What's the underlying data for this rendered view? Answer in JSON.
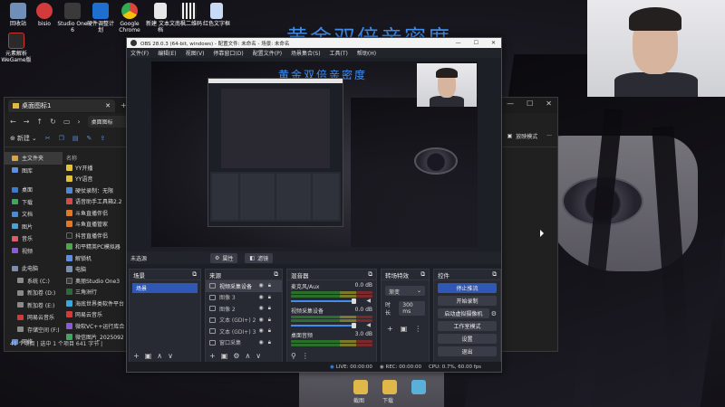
{
  "overlay": {
    "title_main": "黄金双倍亲密度"
  },
  "desktop_icons": [
    {
      "label": "回收站",
      "color": "#6f8fb8"
    },
    {
      "label": "bisio",
      "color": "#d23b3b"
    },
    {
      "label": "Studio One 6",
      "color": "#3a3a3a"
    },
    {
      "label": "硬件调整计划",
      "color": "#1f6fd1"
    },
    {
      "label": "Google Chrome",
      "color": "#e6a21c"
    },
    {
      "label": "新建 文本文档",
      "color": "#e7e7e7"
    },
    {
      "label": "南枫二维码",
      "color": "#f0f0f0"
    },
    {
      "label": "红色文字框",
      "color": "#c9daf7"
    },
    {
      "label": "元素解析 WeGame版",
      "color": "#2a2a2a"
    }
  ],
  "explorer": {
    "tab_label": "桌面图标1",
    "address": "桌面图标",
    "new_button": "新建",
    "focus_mode": "放映模式",
    "nav_items": [
      {
        "label": "主文件夹",
        "color": "#d9a441"
      },
      {
        "label": "图库",
        "color": "#5d8fe0"
      },
      {
        "label": "桌面",
        "color": "#3b7bd8"
      },
      {
        "label": "下载",
        "color": "#3fa75f"
      },
      {
        "label": "文档",
        "color": "#4b8ad8"
      },
      {
        "label": "图片",
        "color": "#4aa0d8"
      },
      {
        "label": "音乐",
        "color": "#e05a6a"
      },
      {
        "label": "视频",
        "color": "#8c5ad8"
      },
      {
        "label": "此电脑",
        "color": "#7a8fb0"
      },
      {
        "label": "系统 (C:)",
        "color": "#8a8a8a"
      },
      {
        "label": "新加卷 (D:)",
        "color": "#8a8a8a"
      },
      {
        "label": "新加卷 (E:)",
        "color": "#8a8a8a"
      },
      {
        "label": "网易云音乐",
        "color": "#d23b3b"
      },
      {
        "label": "存储空间 (F:)",
        "color": "#8a8a8a"
      },
      {
        "label": "网络",
        "color": "#5d8fe0"
      }
    ],
    "files_header": "名称",
    "files": [
      {
        "label": "YY开播",
        "color": "#e0c23b"
      },
      {
        "label": "YY语音",
        "color": "#e0c23b"
      },
      {
        "label": "硬仗录制：无限",
        "color": "#4a8ad8"
      },
      {
        "label": "语音助手工具箱2.2",
        "color": "#d84a4a"
      },
      {
        "label": "斗鱼直播伴侣",
        "color": "#e07a2a"
      },
      {
        "label": "斗鱼直播管家",
        "color": "#e07a2a"
      },
      {
        "label": "抖音直播伴侣",
        "color": "#222222"
      },
      {
        "label": "和平精英PC模拟器",
        "color": "#4aa84a"
      },
      {
        "label": "解锁机",
        "color": "#5d8fe0"
      },
      {
        "label": "电脑",
        "color": "#7a8fb0"
      },
      {
        "label": "奥丽Studio One3",
        "color": "#3a3a3a"
      },
      {
        "label": "三角洲行",
        "color": "#2a6a3a"
      },
      {
        "label": "海底世界类软件平台",
        "color": "#3aa8d8"
      },
      {
        "label": "网易云音乐",
        "color": "#d23b3b"
      },
      {
        "label": "微软VC++运行库合集",
        "color": "#8a5ad8"
      },
      {
        "label": "微信图片_20250925144",
        "color": "#3fa75f"
      }
    ],
    "status": "41 个项目  |  选中 1 个项目  641 字节  |"
  },
  "obs": {
    "title": "OBS 28.0.3 (64-bit, windows) - 配置文件: 未命名 - 场景: 未命名",
    "menu": [
      "文件(F)",
      "编辑(E)",
      "视图(V)",
      "停靠窗口(D)",
      "配置文件(P)",
      "场景集合(S)",
      "工具(T)",
      "帮助(H)"
    ],
    "preview_title": "黄金双倍亲密度",
    "source_bar": {
      "no_source": "未选源",
      "properties": "属性",
      "filters": "滤镜"
    },
    "scenes": {
      "title": "场景",
      "items": [
        "场景"
      ]
    },
    "sources": {
      "title": "来源",
      "items": [
        {
          "label": "视频采集设备",
          "active": true
        },
        {
          "label": "图像 3",
          "active": false
        },
        {
          "label": "图像 2",
          "active": false
        },
        {
          "label": "文本 (GDI+) 2",
          "active": false
        },
        {
          "label": "文本 (GDI+) 3",
          "active": false
        },
        {
          "label": "窗口采集",
          "active": false
        }
      ]
    },
    "mixer": {
      "title": "混音器",
      "channels": [
        {
          "name": "麦克风/Aux",
          "db": "0.0 dB"
        },
        {
          "name": "视频采集设备",
          "db": "0.0 dB"
        },
        {
          "name": "桌面音频",
          "db": "3.0 dB"
        }
      ]
    },
    "transitions": {
      "title": "转场特效",
      "type": "渐变",
      "duration_label": "时长",
      "duration_value": "300 ms"
    },
    "controls": {
      "title": "控件",
      "buttons": [
        "停止推流",
        "开始录制",
        "启动虚拟摄像机",
        "工作室模式",
        "设置",
        "退出"
      ]
    },
    "status": {
      "live": "LIVE: 00:00:00",
      "rec": "REC: 00:00:00",
      "cpu": "CPU: 0.7%, 60.00 fps"
    }
  },
  "taskbar": {
    "label_1": "截图",
    "label_2": "下载"
  }
}
